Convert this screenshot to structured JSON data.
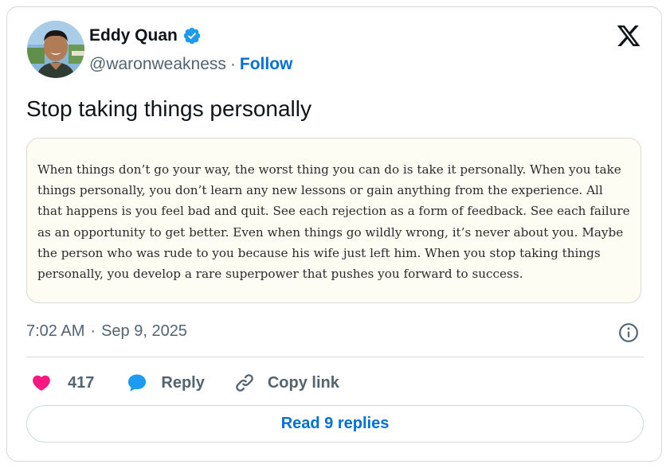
{
  "author": {
    "name": "Eddy Quan",
    "handle": "@waronweakness",
    "separator": "·",
    "follow_label": "Follow",
    "avatar_icon": "profile-photo",
    "verified_icon": "verified-badge-icon"
  },
  "brand": {
    "logo_icon": "x-logo-icon"
  },
  "tweet": {
    "text": "Stop taking things personally",
    "quote_image_text": "When things don’t go your way, the worst thing you can do is take it personally. When you take things personally, you don’t learn any new lessons or gain anything from the experience. All that happens is you feel bad and quit. See each rejection as a form of feedback. See each failure as an opportunity to get better. Even when things go wildly wrong, it’s never about you. Maybe the person who was rude to you because his wife just left him. When you stop taking things personally, you develop a rare superpower that pushes you forward to success."
  },
  "meta": {
    "time": "7:02 AM",
    "separator": "·",
    "date": "Sep 9, 2025",
    "info_icon": "info-icon"
  },
  "actions": {
    "like_count": "417",
    "reply_label": "Reply",
    "copy_link_label": "Copy link"
  },
  "footer": {
    "read_replies_label": "Read 9 replies"
  },
  "colors": {
    "accent": "#006fd6",
    "verified": "#1d9bf0",
    "like": "#f91880",
    "muted_text": "#536471",
    "border": "#cfd9de",
    "quote_background": "#fefdf3"
  }
}
